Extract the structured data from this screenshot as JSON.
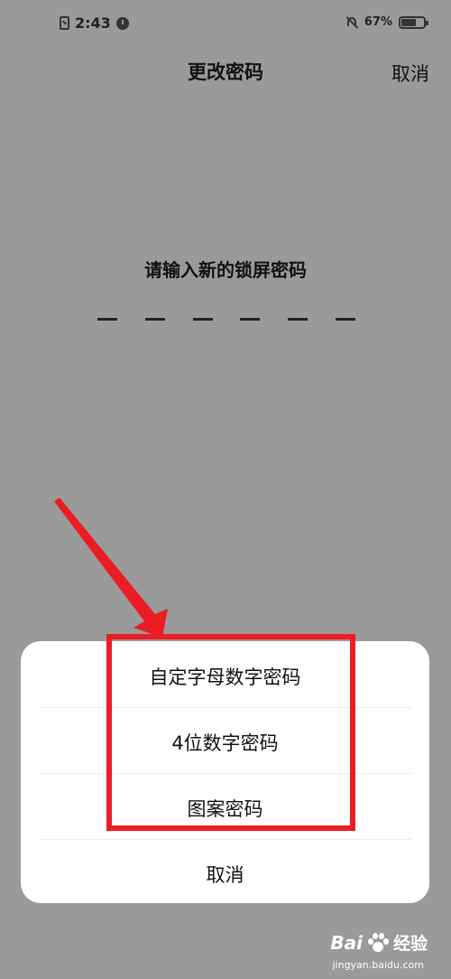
{
  "status_bar": {
    "time": "2:43",
    "battery_percent": "67%",
    "battery_level": 0.67,
    "icons": [
      "sim-icon",
      "clock-badge-icon",
      "bell-off-icon",
      "battery-icon"
    ]
  },
  "header": {
    "title": "更改密码",
    "cancel_label": "取消"
  },
  "prompt": {
    "text": "请输入新的锁屏密码",
    "pin_length": 6
  },
  "sheet": {
    "options": [
      {
        "label": "自定字母数字密码"
      },
      {
        "label": "4位数字密码"
      },
      {
        "label": "图案密码"
      }
    ],
    "cancel_label": "取消"
  },
  "annotation": {
    "highlight_color": "#ec1c24",
    "arrow_color": "#ec1c24"
  },
  "watermark": {
    "brand": "Bai",
    "sub": "经验",
    "url": "jingyan.baidu.com"
  }
}
